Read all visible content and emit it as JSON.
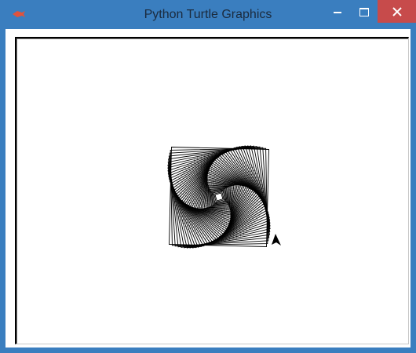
{
  "window": {
    "title": "Python Turtle Graphics",
    "app_icon": "turtle-app-icon",
    "buttons": {
      "minimize": "minimize-icon",
      "maximize": "maximize-icon",
      "close": "close-icon"
    }
  },
  "colors": {
    "titlebar": "#3a7ebf",
    "close_button": "#c74b4b",
    "canvas_background": "#ffffff",
    "pen": "#000000"
  },
  "canvas": {
    "drawing": "spiral-square-pattern",
    "turtle": "turtle-cursor-icon"
  }
}
